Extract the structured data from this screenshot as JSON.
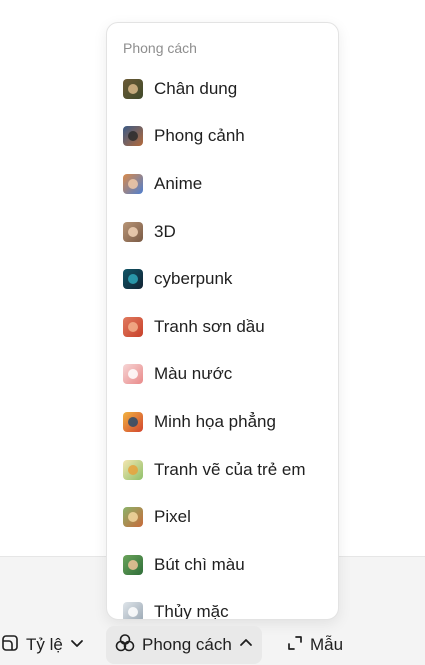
{
  "menu": {
    "header": "Phong cách",
    "items": [
      {
        "label": "Chân dung",
        "icon": "portrait-thumb-icon",
        "colors": [
          "#6b5a36",
          "#3f4a2a",
          "#d8b98a"
        ]
      },
      {
        "label": "Phong cảnh",
        "icon": "landscape-thumb-icon",
        "colors": [
          "#3a5a86",
          "#b46a3a",
          "#2b2b2b"
        ]
      },
      {
        "label": "Anime",
        "icon": "anime-thumb-icon",
        "colors": [
          "#d98a4a",
          "#4f7fd0",
          "#f0c9a8"
        ]
      },
      {
        "label": "3D",
        "icon": "3d-thumb-icon",
        "colors": [
          "#b89576",
          "#7a5a45",
          "#f1d2b6"
        ]
      },
      {
        "label": "cyberpunk",
        "icon": "cyberpunk-thumb-icon",
        "colors": [
          "#0f5566",
          "#122233",
          "#2ea6b8"
        ]
      },
      {
        "label": "Tranh sơn dầu",
        "icon": "oil-painting-thumb-icon",
        "colors": [
          "#e07a5f",
          "#c8412a",
          "#f3b08c"
        ]
      },
      {
        "label": "Màu nước",
        "icon": "watercolor-thumb-icon",
        "colors": [
          "#f6d5d5",
          "#e98a8a",
          "#ffffff"
        ]
      },
      {
        "label": "Minh họa phẳng",
        "icon": "flat-illustration-thumb-icon",
        "colors": [
          "#f1b340",
          "#d2452f",
          "#2c4a6b"
        ]
      },
      {
        "label": "Tranh vẽ của trẻ em",
        "icon": "kids-drawing-thumb-icon",
        "colors": [
          "#f5e6b0",
          "#8fc06b",
          "#e6a23c"
        ]
      },
      {
        "label": "Pixel",
        "icon": "pixel-thumb-icon",
        "colors": [
          "#8bb36a",
          "#c86a3a",
          "#f2d7a0"
        ]
      },
      {
        "label": "Bút chì màu",
        "icon": "colored-pencil-thumb-icon",
        "colors": [
          "#6aa35a",
          "#2f6e3a",
          "#f0c39a"
        ]
      },
      {
        "label": "Thủy mặc",
        "icon": "ink-wash-thumb-icon",
        "colors": [
          "#dfe5ea",
          "#9aa7b3",
          "#ffffff"
        ]
      }
    ]
  },
  "toolbar": {
    "ratio_label": "Tỷ lệ",
    "style_label": "Phong cách",
    "sample_label": "Mẫu"
  }
}
